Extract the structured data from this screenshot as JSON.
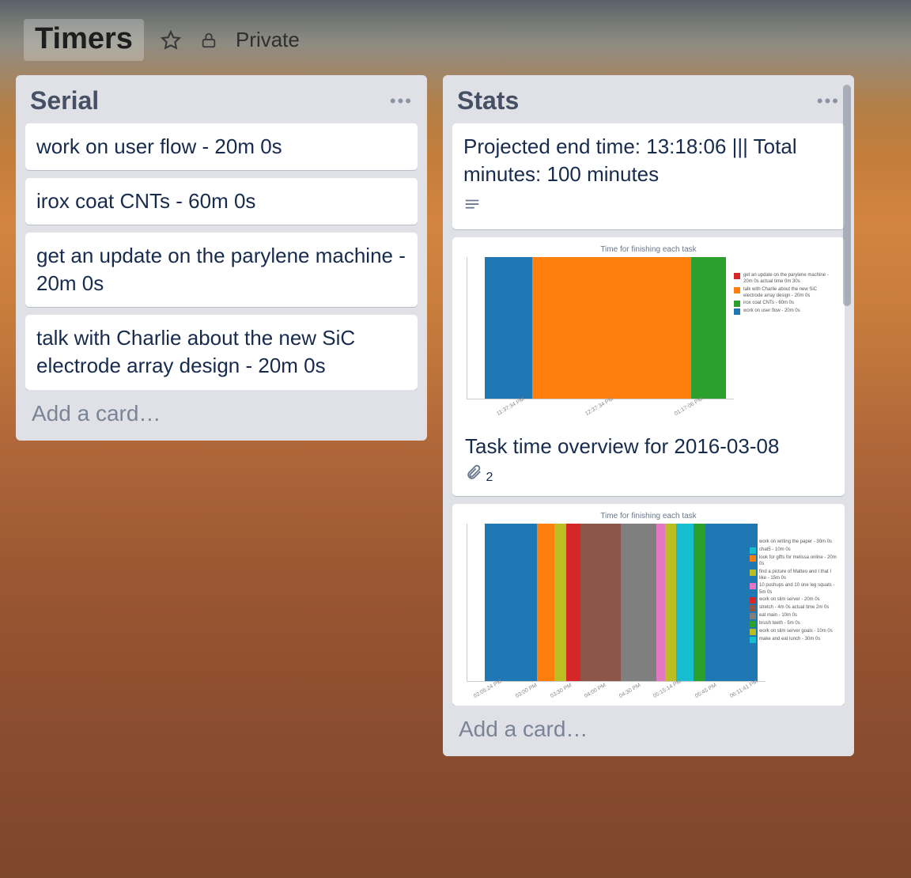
{
  "header": {
    "board_title": "Timers",
    "privacy_label": "Private"
  },
  "lists": [
    {
      "title": "Serial",
      "add_card_label": "Add a card…",
      "cards": [
        {
          "text": "work on user flow - 20m 0s"
        },
        {
          "text": "irox coat CNTs - 60m 0s"
        },
        {
          "text": "get an update on the parylene machine - 20m 0s"
        },
        {
          "text": "talk with Charlie about the new SiC electrode array design - 20m 0s"
        }
      ]
    },
    {
      "title": "Stats",
      "add_card_label": "Add a card…",
      "cards": [
        {
          "text": "Projected end time: 13:18:06 ||| Total minutes: 100 minutes",
          "has_description": true
        },
        {
          "chart_ref": 0,
          "title": "Task time overview for 2016-03-08",
          "attachments": 2
        },
        {
          "chart_ref": 1
        }
      ]
    }
  ],
  "chart_data": [
    {
      "type": "bar",
      "title": "Time for finishing each task",
      "x_ticks": [
        "11:37:34 PM",
        "12:37:34 PM",
        "01:17:06 PM"
      ],
      "series": [
        {
          "name": "get an update on the parylene machine - 20m 0s actual time 0m 30s",
          "color": "#d62728",
          "width": 0
        },
        {
          "name": "talk with Charlie about the new SiC electrode array design - 20m 0s",
          "color": "#ff7f0e",
          "width": 60
        },
        {
          "name": "irox coat CNTs - 60m 0s",
          "color": "#2ca02c",
          "width": 13
        },
        {
          "name": "work on user flow - 20m 0s",
          "color": "#1f77b4",
          "width": 18
        }
      ],
      "bar_order": [
        "#1f77b4",
        "#ff7f0e",
        "#2ca02c"
      ]
    },
    {
      "type": "bar",
      "title": "Time for finishing each task",
      "x_ticks": [
        "02:05:24 PM",
        "03:00 PM",
        "03:30 PM",
        "04:00 PM",
        "04:30 PM",
        "05:15:14 PM",
        "05:45 PM",
        "06:11:41 PM"
      ],
      "series": [
        {
          "name": "work on writing the paper - 30m 0s",
          "color": "#1f77b4",
          "width": 18
        },
        {
          "name": "chat5 - 10m 0s",
          "color": "#17becf",
          "width": 6
        },
        {
          "name": "look for gifts for melissa online - 20m 0s",
          "color": "#ff7f0e",
          "width": 6
        },
        {
          "name": "find a picture of Matteo and I that I like - 15m 0s",
          "color": "#bcbd22",
          "width": 4
        },
        {
          "name": "10 pushups and 10 one leg squats - 5m 0s",
          "color": "#e377c2",
          "width": 3
        },
        {
          "name": "work on slim server - 20m 0s",
          "color": "#d62728",
          "width": 5
        },
        {
          "name": "stretch - 4m 0s actual time 2m 0s",
          "color": "#8c564b",
          "width": 14
        },
        {
          "name": "eat main - 10m 0s",
          "color": "#7f7f7f",
          "width": 12
        },
        {
          "name": "brush teeth - 5m 0s",
          "color": "#2ca02c",
          "width": 4
        },
        {
          "name": "work on slim server goals - 10m 0s",
          "color": "#bcbd22",
          "width": 12
        },
        {
          "name": "make and eat lunch - 30m 0s",
          "color": "#17becf",
          "width": 6
        }
      ],
      "bar_order": [
        "#1f77b4",
        "#ff7f0e",
        "#bcbd22",
        "#d62728",
        "#8c564b",
        "#7f7f7f",
        "#e377c2",
        "#bcbd22",
        "#17becf",
        "#2ca02c",
        "#1f77b4"
      ]
    }
  ]
}
